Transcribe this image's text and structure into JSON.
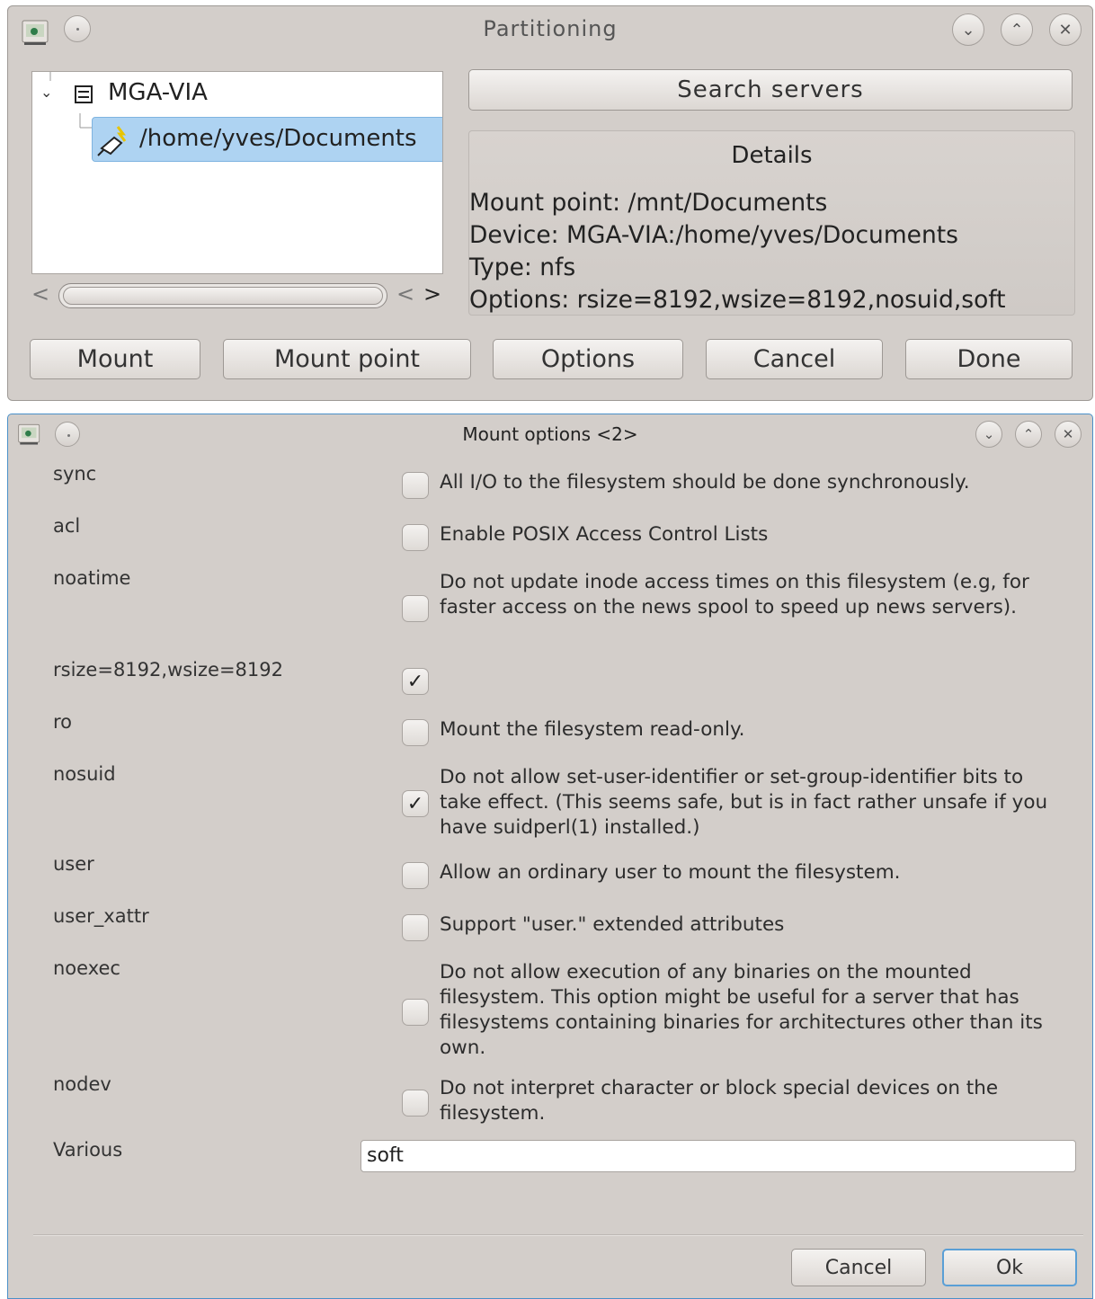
{
  "partitioning": {
    "title": "Partitioning",
    "tree": {
      "server": "MGA-VIA",
      "share": "/home/yves/Documents"
    },
    "scroll_left": "<",
    "scroll_left2": "<",
    "scroll_right": ">",
    "search_servers": "Search servers",
    "details": {
      "heading": "Details",
      "mount_point": "Mount point: /mnt/Documents",
      "device": "Device: MGA-VIA:/home/yves/Documents",
      "type": "Type: nfs",
      "options": "Options: rsize=8192,wsize=8192,nosuid,soft"
    },
    "buttons": {
      "mount": "Mount",
      "mount_point": "Mount point",
      "options": "Options",
      "cancel": "Cancel",
      "done": "Done"
    }
  },
  "mount_options": {
    "title": "Mount options <2>",
    "options": [
      {
        "name": "sync",
        "checked": false,
        "desc": "All I/O to the filesystem should be done synchronously."
      },
      {
        "name": "acl",
        "checked": false,
        "desc": "Enable POSIX Access Control Lists"
      },
      {
        "name": "noatime",
        "checked": false,
        "desc": "Do not update inode access times on this filesystem (e.g, for faster access on the news spool to speed up news servers)."
      },
      {
        "name": "rsize=8192,wsize=8192",
        "checked": true,
        "desc": ""
      },
      {
        "name": "ro",
        "checked": false,
        "desc": "Mount the filesystem read-only."
      },
      {
        "name": "nosuid",
        "checked": true,
        "desc": "Do not allow set-user-identifier or set-group-identifier bits to take effect. (This seems safe, but is in fact rather unsafe if you have suidperl(1) installed.)"
      },
      {
        "name": "user",
        "checked": false,
        "desc": "Allow an ordinary user to mount the filesystem."
      },
      {
        "name": "user_xattr",
        "checked": false,
        "desc": "Support \"user.\" extended attributes"
      },
      {
        "name": "noexec",
        "checked": false,
        "desc": "Do not allow execution of any binaries on the mounted filesystem. This option might be useful for a server that has filesystems containing binaries for architectures other than its own."
      },
      {
        "name": "nodev",
        "checked": false,
        "desc": "Do not interpret character or block special devices on the filesystem."
      }
    ],
    "various_label": "Various",
    "various_value": "soft",
    "cancel": "Cancel",
    "ok": "Ok"
  },
  "icons": {
    "app": "mageia-control-center-icon",
    "menu": "window-menu-icon",
    "minimize": "chevron-down-icon",
    "maximize": "chevron-up-icon",
    "close": "close-icon",
    "server": "server-icon",
    "share": "network-share-icon",
    "expand": "tree-expand-arrow-icon"
  },
  "colors": {
    "window_bg": "#d3ceca",
    "selection": "#aed3f2",
    "focus_border": "#4a90c8"
  }
}
